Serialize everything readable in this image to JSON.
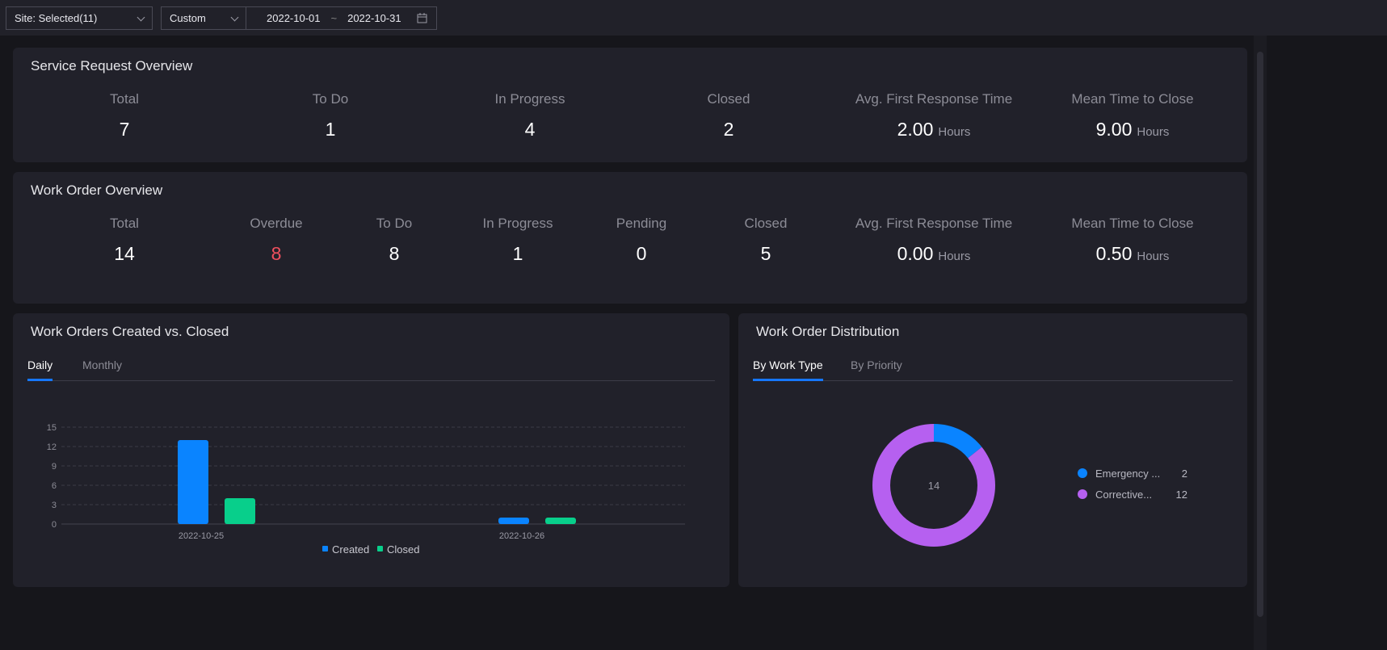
{
  "filters": {
    "site": "Site: Selected(11)",
    "range_type": "Custom",
    "date_start": "2022-10-01",
    "date_sep": "~",
    "date_end": "2022-10-31"
  },
  "service_request": {
    "title": "Service Request Overview",
    "stats": [
      {
        "label": "Total",
        "value": "7"
      },
      {
        "label": "To Do",
        "value": "1"
      },
      {
        "label": "In Progress",
        "value": "4"
      },
      {
        "label": "Closed",
        "value": "2"
      },
      {
        "label": "Avg. First Response Time",
        "value": "2.00",
        "unit": "Hours"
      },
      {
        "label": "Mean Time to Close",
        "value": "9.00",
        "unit": "Hours"
      }
    ]
  },
  "work_order": {
    "title": "Work Order Overview",
    "stats": [
      {
        "label": "Total",
        "value": "14"
      },
      {
        "label": "Overdue",
        "value": "8"
      },
      {
        "label": "To Do",
        "value": "8"
      },
      {
        "label": "In Progress",
        "value": "1"
      },
      {
        "label": "Pending",
        "value": "0"
      },
      {
        "label": "Closed",
        "value": "5"
      },
      {
        "label": "Avg. First Response Time",
        "value": "0.00",
        "unit": "Hours"
      },
      {
        "label": "Mean Time to Close",
        "value": "0.50",
        "unit": "Hours"
      }
    ]
  },
  "created_closed": {
    "title": "Work Orders Created vs. Closed",
    "tabs": [
      "Daily",
      "Monthly"
    ]
  },
  "distribution": {
    "title": "Work Order Distribution",
    "tabs": [
      "By Work Type",
      "By Priority"
    ]
  },
  "colors": {
    "created": "#0a84ff",
    "closed": "#08cf8b",
    "emergency": "#0a84ff",
    "corrective": "#b660f0",
    "overdue": "#f0505e"
  },
  "chart_data": [
    {
      "type": "bar",
      "categories": [
        "2022-10-25",
        "2022-10-26"
      ],
      "series": [
        {
          "name": "Created",
          "values": [
            13,
            1
          ]
        },
        {
          "name": "Closed",
          "values": [
            4,
            1
          ]
        }
      ],
      "yticks": [
        0,
        3,
        6,
        9,
        12,
        15
      ],
      "ylim": [
        0,
        15
      ],
      "legend": "bottom",
      "grid": true
    },
    {
      "type": "pie",
      "center_label": "14",
      "slices": [
        {
          "label": "Emergency ...",
          "value": 2
        },
        {
          "label": "Corrective...",
          "value": 12
        }
      ],
      "legend": "right"
    }
  ]
}
